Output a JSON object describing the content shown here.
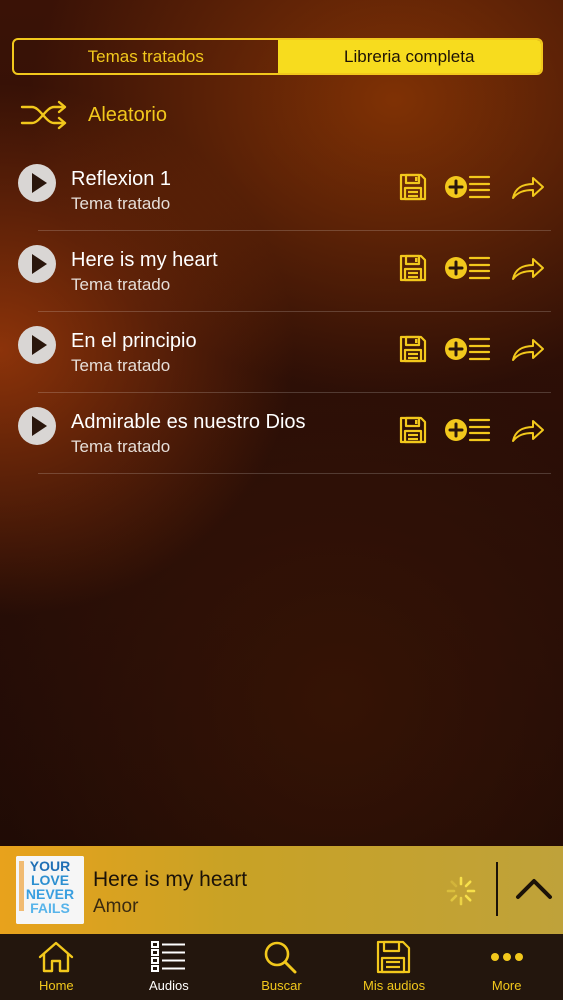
{
  "segment": {
    "left_label": "Temas tratados",
    "right_label": "Libreria completa",
    "selected": "Libreria completa"
  },
  "shuffle": {
    "label": "Aleatorio",
    "icon": "shuffle-icon"
  },
  "tracks": [
    {
      "title": "Reflexion 1",
      "subtitle": "Tema tratado"
    },
    {
      "title": "Here is my heart",
      "subtitle": "Tema tratado"
    },
    {
      "title": "En el principio",
      "subtitle": "Tema tratado"
    },
    {
      "title": "Admirable es nuestro Dios",
      "subtitle": "Tema tratado"
    }
  ],
  "now_playing": {
    "title": "Here is my heart",
    "subtitle": "Amor",
    "album_art_text": "YOUR LOVE NEVER FAILS"
  },
  "tabbar": [
    {
      "label": "Home",
      "icon": "home-icon"
    },
    {
      "label": "Audios",
      "icon": "list-icon",
      "active": true
    },
    {
      "label": "Buscar",
      "icon": "search-icon"
    },
    {
      "label": "Mis audios",
      "icon": "save-icon"
    },
    {
      "label": "More",
      "icon": "more-icon"
    }
  ],
  "colors": {
    "accent": "#f2c81c",
    "segment_selected_bg": "#f7dc1e",
    "tabbar_bg": "#23160d",
    "mini_player_bg": "#d4a22a"
  }
}
